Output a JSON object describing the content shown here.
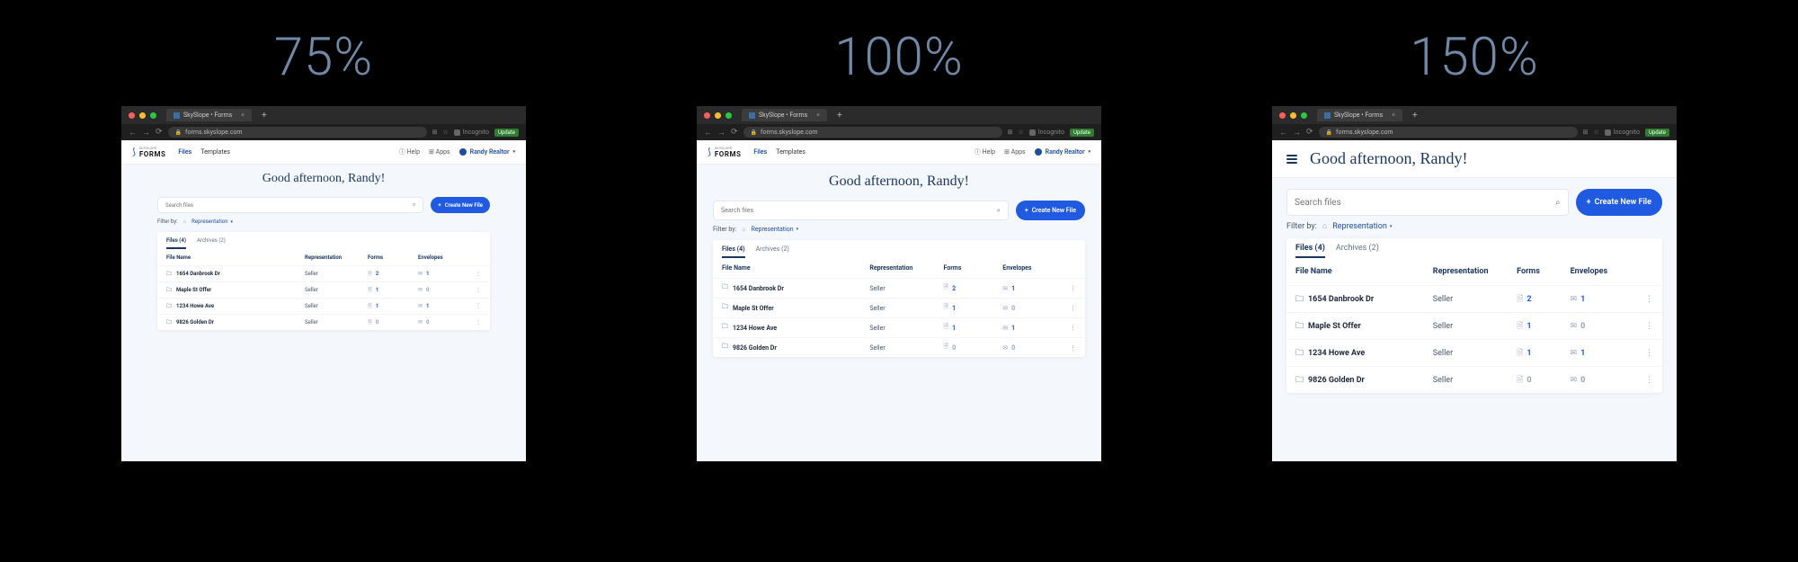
{
  "zoom_labels": {
    "a": "75%",
    "b": "100%",
    "c": "150%"
  },
  "browser": {
    "tab_title": "SkySlope • Forms",
    "url": "forms.skyslope.com",
    "incognito_label": "Incognito",
    "update_label": "Update"
  },
  "app": {
    "brand_sub": "SKYSLOPE",
    "brand": "FORMS",
    "nav": {
      "files": "Files",
      "templates": "Templates"
    },
    "header": {
      "help": "Help",
      "apps": "Apps",
      "user": "Randy Realtor"
    }
  },
  "greeting": "Good afternoon, Randy!",
  "search": {
    "placeholder": "Search files"
  },
  "cta_label": "Create New File",
  "filter": {
    "label": "Filter by:",
    "value": "Representation"
  },
  "tabs": {
    "files": "Files (4)",
    "archives": "Archives (2)"
  },
  "columns": {
    "fname": "File Name",
    "rep": "Representation",
    "forms": "Forms",
    "env": "Envelopes"
  },
  "rows": [
    {
      "name": "1654 Danbrook Dr",
      "rep": "Seller",
      "forms": "2",
      "env": "1"
    },
    {
      "name": "Maple St Offer",
      "rep": "Seller",
      "forms": "1",
      "env": "0"
    },
    {
      "name": "1234 Howe Ave",
      "rep": "Seller",
      "forms": "1",
      "env": "1"
    },
    {
      "name": "9826 Golden Dr",
      "rep": "Seller",
      "forms": "0",
      "env": "0"
    }
  ]
}
